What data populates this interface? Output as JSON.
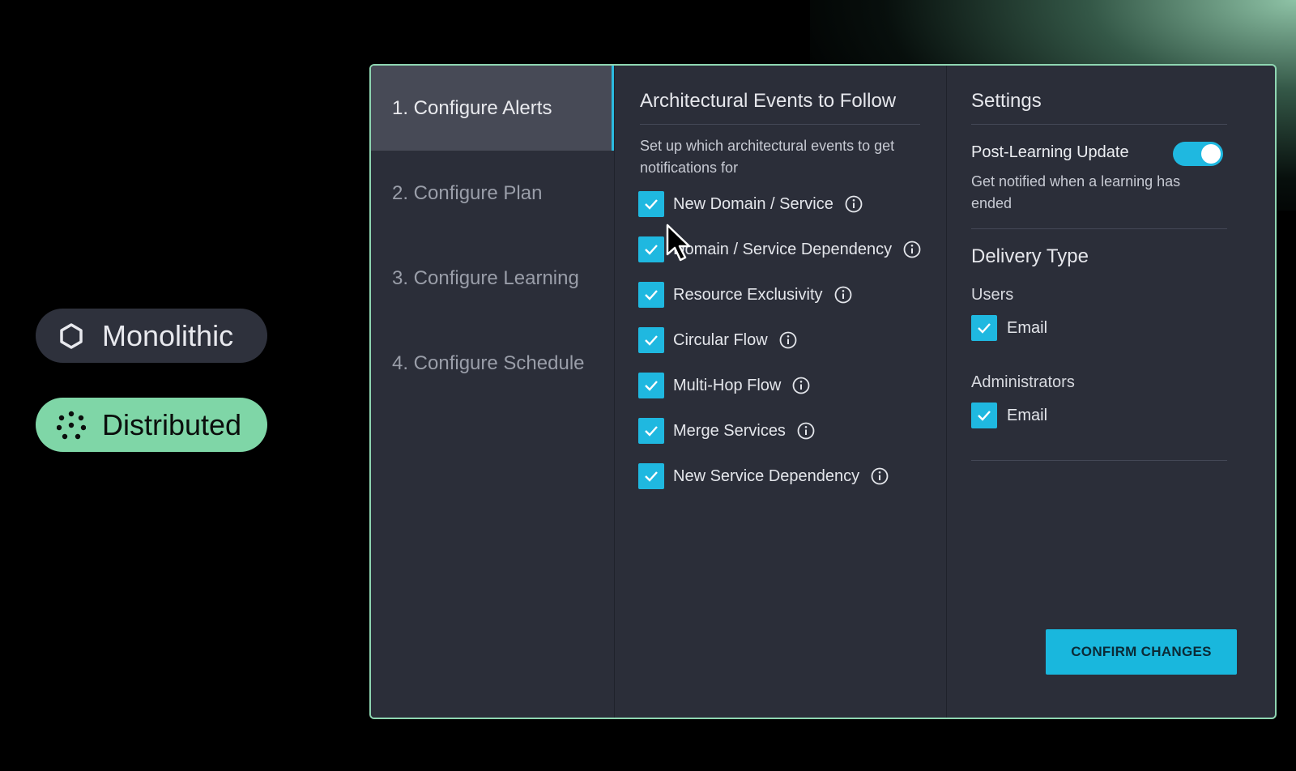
{
  "architecture_options": [
    {
      "label": "Monolithic",
      "icon": "hexagon-icon",
      "selected": false
    },
    {
      "label": "Distributed",
      "icon": "dots-cluster-icon",
      "selected": true
    }
  ],
  "nav": {
    "items": [
      {
        "label": "1. Configure Alerts",
        "active": true
      },
      {
        "label": "2. Configure Plan",
        "active": false
      },
      {
        "label": "3. Configure Learning",
        "active": false
      },
      {
        "label": "4. Configure Schedule",
        "active": false
      }
    ]
  },
  "events": {
    "title": "Architectural Events to Follow",
    "description": "Set up which architectural events to get notifications for",
    "items": [
      {
        "label": "New Domain / Service",
        "checked": true,
        "icon": "info-icon"
      },
      {
        "label": "Domain / Service Dependency",
        "checked": true,
        "icon": "info-icon"
      },
      {
        "label": "Resource Exclusivity",
        "checked": true,
        "icon": "info-icon"
      },
      {
        "label": "Circular Flow",
        "checked": true,
        "icon": "info-icon"
      },
      {
        "label": "Multi-Hop Flow",
        "checked": true,
        "icon": "info-icon"
      },
      {
        "label": "Merge Services",
        "checked": true,
        "icon": "info-icon"
      },
      {
        "label": "New Service Dependency",
        "checked": true,
        "icon": "info-icon"
      }
    ]
  },
  "settings": {
    "title": "Settings",
    "post_learning": {
      "label": "Post-Learning Update",
      "enabled": true,
      "description": "Get notified when a learning has ended"
    },
    "delivery": {
      "title": "Delivery Type",
      "groups": [
        {
          "label": "Users",
          "option": "Email",
          "checked": true
        },
        {
          "label": "Administrators",
          "option": "Email",
          "checked": true
        }
      ]
    },
    "confirm_label": "CONFIRM CHANGES"
  },
  "colors": {
    "accent": "#1fb8e0",
    "panel_border": "#8fd6b2",
    "distributed_pill": "#7fd6a7"
  }
}
